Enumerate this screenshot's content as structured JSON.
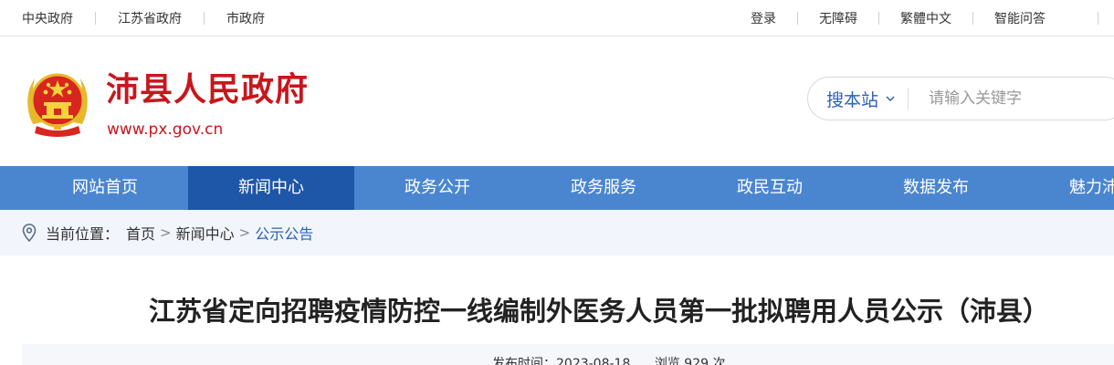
{
  "topbar": {
    "left_links": [
      "中央政府",
      "江苏省政府",
      "市政府"
    ],
    "right_links": [
      "登录",
      "无障碍",
      "繁體中文",
      "智能问答"
    ]
  },
  "header": {
    "site_name": "沛县人民政府",
    "site_url": "www.px.gov.cn"
  },
  "search": {
    "scope_label": "搜本站",
    "placeholder": "请输入关键字"
  },
  "nav": {
    "items": [
      "网站首页",
      "新闻中心",
      "政务公开",
      "政务服务",
      "政民互动",
      "数据发布",
      "魅力沛县"
    ],
    "active_index": 1
  },
  "breadcrumb": {
    "label": "当前位置：",
    "home": "首页",
    "section": "新闻中心",
    "current": "公示公告",
    "separator": ">"
  },
  "article": {
    "title": "江苏省定向招聘疫情防控一线编制外医务人员第一批拟聘用人员公示（沛县）",
    "publish_label": "发布时间：",
    "publish_date": "2023-08-18",
    "views_label": "浏览",
    "views_count": "929",
    "views_unit": "次"
  },
  "colors": {
    "brand_red": "#c8161d",
    "nav_blue": "#4a86d0",
    "nav_active": "#1e56a8",
    "link_blue": "#2b62b5"
  }
}
